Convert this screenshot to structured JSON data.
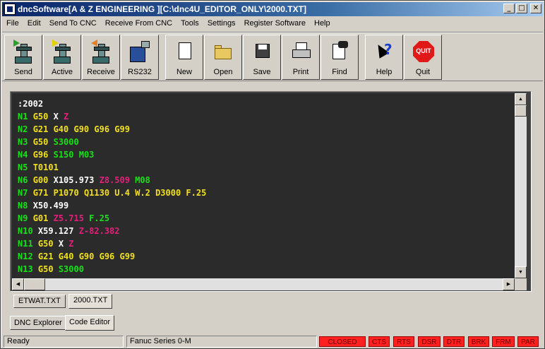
{
  "window": {
    "title": "dncSoftware[A & Z ENGINEERING ][C:\\dnc4U_EDITOR_ONLY\\2000.TXT]",
    "controls": [
      "_",
      "□",
      "✕"
    ]
  },
  "menu": [
    "File",
    "Edit",
    "Send To CNC",
    "Receive From CNC",
    "Tools",
    "Settings",
    "Register Software",
    "Help"
  ],
  "toolbar": {
    "send": "Send",
    "active": "Active",
    "receive": "Receive",
    "rs232": "RS232",
    "new": "New",
    "open": "Open",
    "save": "Save",
    "print": "Print",
    "find": "Find",
    "help": "Help",
    "quit": "Quit",
    "quit_icon_text": "QUIT"
  },
  "code_lines": [
    [
      {
        "t": ":2002",
        "c": "w"
      }
    ],
    [
      {
        "t": "N1 ",
        "c": "n"
      },
      {
        "t": "G50 ",
        "c": "y"
      },
      {
        "t": "X ",
        "c": "w"
      },
      {
        "t": "Z",
        "c": "m"
      }
    ],
    [
      {
        "t": "N2 ",
        "c": "n"
      },
      {
        "t": "G21 G40 G90 G96 G99",
        "c": "y"
      }
    ],
    [
      {
        "t": "N3 ",
        "c": "n"
      },
      {
        "t": "G50 ",
        "c": "y"
      },
      {
        "t": "S3000",
        "c": "g"
      }
    ],
    [
      {
        "t": "N4 ",
        "c": "n"
      },
      {
        "t": "G96 ",
        "c": "y"
      },
      {
        "t": "S150 ",
        "c": "g"
      },
      {
        "t": "M03",
        "c": "g"
      }
    ],
    [
      {
        "t": "N5 ",
        "c": "n"
      },
      {
        "t": "T0101",
        "c": "y"
      }
    ],
    [
      {
        "t": "N6 ",
        "c": "n"
      },
      {
        "t": "G00 ",
        "c": "y"
      },
      {
        "t": "X105.973 ",
        "c": "w"
      },
      {
        "t": "Z8.509 ",
        "c": "m"
      },
      {
        "t": "M08",
        "c": "g"
      }
    ],
    [
      {
        "t": "N7 ",
        "c": "n"
      },
      {
        "t": "G71 ",
        "c": "y"
      },
      {
        "t": "P1070 Q1130 U.4 W.2 D3000 F.25",
        "c": "y"
      }
    ],
    [
      {
        "t": "N8 ",
        "c": "n"
      },
      {
        "t": "X50.499",
        "c": "w"
      }
    ],
    [
      {
        "t": "N9 ",
        "c": "n"
      },
      {
        "t": "G01 ",
        "c": "y"
      },
      {
        "t": "Z5.715 ",
        "c": "m"
      },
      {
        "t": "F.25",
        "c": "g"
      }
    ],
    [
      {
        "t": "N10 ",
        "c": "n"
      },
      {
        "t": "X59.127 ",
        "c": "w"
      },
      {
        "t": "Z-82.382",
        "c": "m"
      }
    ],
    [
      {
        "t": "N11 ",
        "c": "n"
      },
      {
        "t": "G50 ",
        "c": "y"
      },
      {
        "t": "X ",
        "c": "w"
      },
      {
        "t": "Z",
        "c": "m"
      }
    ],
    [
      {
        "t": "N12 ",
        "c": "n"
      },
      {
        "t": "G21 G40 G90 G96 G99",
        "c": "y"
      }
    ],
    [
      {
        "t": "N13 ",
        "c": "n"
      },
      {
        "t": "G50 ",
        "c": "y"
      },
      {
        "t": "S3000",
        "c": "g"
      }
    ]
  ],
  "file_tabs": [
    "ETWAT.TXT",
    "2000.TXT"
  ],
  "active_file_tab": "2000.TXT",
  "bottom_tabs": [
    "DNC Explorer",
    "Code Editor"
  ],
  "active_bottom_tab": "Code Editor",
  "status": {
    "state": "Ready",
    "machine": "Fanuc Series 0-M",
    "port": "CLOSED",
    "flags": [
      "CTS",
      "RTS",
      "DSR",
      "DTR",
      "BRK",
      "FRM",
      "PAR"
    ]
  },
  "colors": {
    "code_bg": "#2b2b2b",
    "block_number": "#18e018",
    "g_code": "#f0e020",
    "x_axis": "#ffffff",
    "z_axis": "#e0207a",
    "flag_red": "#ff2020"
  }
}
